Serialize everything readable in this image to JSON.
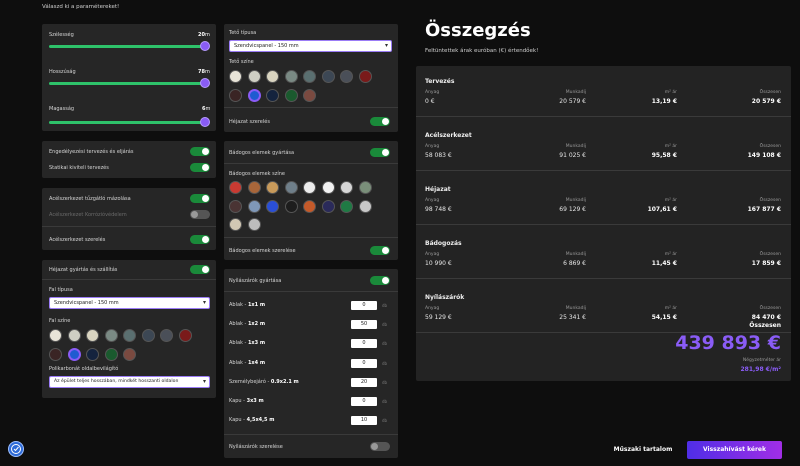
{
  "header": {
    "instruction": "Válaszd ki a paramétereket!"
  },
  "sliders": [
    {
      "label": "Szélesség",
      "value": "20",
      "unit": "m"
    },
    {
      "label": "Hosszúság",
      "value": "78",
      "unit": "m"
    },
    {
      "label": "Magasság",
      "value": "6",
      "unit": "m"
    }
  ],
  "toggles_left": [
    {
      "label": "Engedélyezési tervezés és eljárás",
      "on": true
    },
    {
      "label": "Statikai kiviteli tervezés",
      "on": true
    },
    {
      "label": "Acélszerkezet tűzgátló mázolása",
      "on": true
    },
    {
      "label": "Acélszerkezet Korrózióvédelem",
      "on": false
    },
    {
      "label": "Acélszerkezet szerelés",
      "on": true
    },
    {
      "label": "Héjazat gyártás és szállítás",
      "on": true
    }
  ],
  "wall": {
    "type_label": "Fal típusa",
    "type_value": "Szendvicspanel - 150 mm",
    "color_label": "Fal színe",
    "gutter_label": "Polikarbonát oldalbevilágító",
    "gutter_value": "Az épület teljes hosszában, mindkét hosszanti oldalon"
  },
  "roof": {
    "type_label": "Tető típusa",
    "type_value": "Szendvicspanel - 150 mm",
    "color_label": "Tető színe",
    "install_label": "Héjazat szerelés"
  },
  "flashing": {
    "production_label": "Bádogos elemek gyártása",
    "color_label": "Bádogos elemek színe",
    "install_label": "Bádogos elemek szerelése"
  },
  "openings": {
    "production_label": "Nyílászárók gyártása",
    "items": [
      {
        "name": "Ablak - ",
        "size": "1x1 m",
        "qty": "0",
        "unit": "db"
      },
      {
        "name": "Ablak - ",
        "size": "1x2 m",
        "qty": "50",
        "unit": "db"
      },
      {
        "name": "Ablak - ",
        "size": "1x3 m",
        "qty": "0",
        "unit": "db"
      },
      {
        "name": "Ablak - ",
        "size": "1x4 m",
        "qty": "0",
        "unit": "db"
      },
      {
        "name": "Személybejáró - ",
        "size": "0.9x2.1 m",
        "qty": "20",
        "unit": "db"
      },
      {
        "name": "Kapu - ",
        "size": "3x3 m",
        "qty": "0",
        "unit": "db"
      },
      {
        "name": "Kapu - ",
        "size": "4,5x4,5 m",
        "qty": "10",
        "unit": "db"
      }
    ],
    "install_label": "Nyílászárók szerelése"
  },
  "colors": {
    "wall": [
      "#e8e4d8",
      "#cfcfc4",
      "#d9d4c0",
      "#7a8a84",
      "#5a6f70",
      "#3c4754",
      "#4a4f58",
      "#7a1a1a",
      "#3a2424",
      "#1f5bd1",
      "#14233e",
      "#1a5a2e",
      "#7a4a40"
    ],
    "roof": [
      "#e8e4d8",
      "#cfcfc4",
      "#d9d4c0",
      "#7a8a84",
      "#5a6f70",
      "#3c4754",
      "#4a4f58",
      "#7a1a1a",
      "#3a2424",
      "#1f5bd1",
      "#14233e",
      "#1a5a2e",
      "#7a4a40"
    ],
    "flashing": [
      "#c93a32",
      "#a8663a",
      "#c89a5a",
      "#6f7f8a",
      "#ececec",
      "#f2f2f2",
      "#d6d6d6",
      "#7a8f7a",
      "#4a3434",
      "#7f98b8",
      "#2a4fd6",
      "#1d1d1d",
      "#c45a2a",
      "#2a2a5a",
      "#1f7a44",
      "#c8c8c8",
      "#d2c8b4",
      "#bdbdbd"
    ],
    "accent": "#8a5cf6",
    "toggle_on": "#1a8a3a"
  },
  "summary": {
    "title": "Összegzés",
    "subtitle": "Feltüntettek árak euróban (€) értendőek!",
    "col_labels": {
      "material": "Anyag",
      "labor": "Munkadíj",
      "sqm": "m² ár",
      "total": "Összesen"
    },
    "sections": [
      {
        "name": "Tervezés",
        "material": "0 €",
        "labor": "20 579 €",
        "sqm": "13,19 €",
        "total": "20 579 €"
      },
      {
        "name": "Acélszerkezet",
        "material": "58 083 €",
        "labor": "91 025 €",
        "sqm": "95,58 €",
        "total": "149 108 €"
      },
      {
        "name": "Héjazat",
        "material": "98 748 €",
        "labor": "69 129 €",
        "sqm": "107,61 €",
        "total": "167 877 €"
      },
      {
        "name": "Bádogozás",
        "material": "10 990 €",
        "labor": "6 869 €",
        "sqm": "11,45 €",
        "total": "17 859 €"
      },
      {
        "name": "Nyílászárók",
        "material": "59 129 €",
        "labor": "25 341 €",
        "sqm": "54,15 €",
        "total": "84 470 €"
      }
    ],
    "grand_label": "Összesen",
    "grand_total": "439 893 €",
    "sqm_label": "Négyzetméter ár",
    "sqm_total": "281,98 €/m²"
  },
  "buttons": {
    "tech": "Műszaki tartalom",
    "callback": "Visszahívást kérek"
  }
}
